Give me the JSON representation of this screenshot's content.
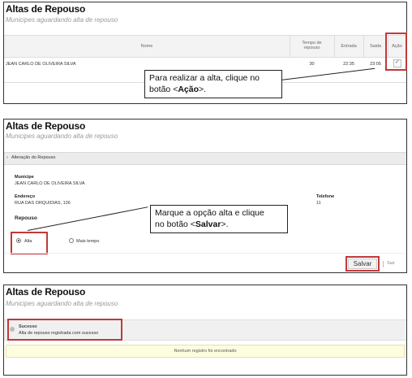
{
  "panel1": {
    "title": "Altas de Repouso",
    "subtitle": "Municipes aguardando alta de repouso",
    "columns": {
      "nome": "Nome",
      "tempo_line1": "Tempo de",
      "tempo_line2": "repouso",
      "entrada": "Entrada",
      "saida": "Saida",
      "acao": "Ação"
    },
    "row": {
      "nome": "JEAN CARLO DE OLIVEIRA SILVA",
      "tempo": "30",
      "entrada": "22:35",
      "saida": "23:05"
    },
    "callout_line1": "Para realizar a alta, clique no",
    "callout_line2_prefix": "botão <",
    "callout_line2_bold": "Ação",
    "callout_line2_suffix": ">."
  },
  "panel2": {
    "title": "Altas de Repouso",
    "subtitle": "Municipes aguardando alta de repouso",
    "section": "Alteração do Repouso",
    "municipe_label": "Municipe",
    "municipe_value": "JEAN CARLO DE OLIVEIRA SILVA",
    "endereco_label": "Endereço",
    "endereco_value": "RUA DAS ORQUIDIAS, 136",
    "telefone_label": "Telefone",
    "telefone_value": "11",
    "repouso_label": "Repouso",
    "option_alta": "Alta",
    "option_mais": "Mais tempo",
    "salvar": "Salvar",
    "sair": "Sair",
    "callout_line1": "Marque a opção alta e clique",
    "callout_line2_prefix": "no botão <",
    "callout_line2_bold": "Salvar",
    "callout_line2_suffix": ">."
  },
  "panel3": {
    "title": "Altas de Repouso",
    "subtitle": "Municipes aguardando alta de repouso",
    "success_title": "Sucesso",
    "success_msg": "Alta de repouso registrada com sucesso",
    "empty_msg": "Nenhum registro foi encontrado"
  },
  "colors": {
    "highlight": "#c0393b",
    "notice_bg": "#fffde0"
  }
}
